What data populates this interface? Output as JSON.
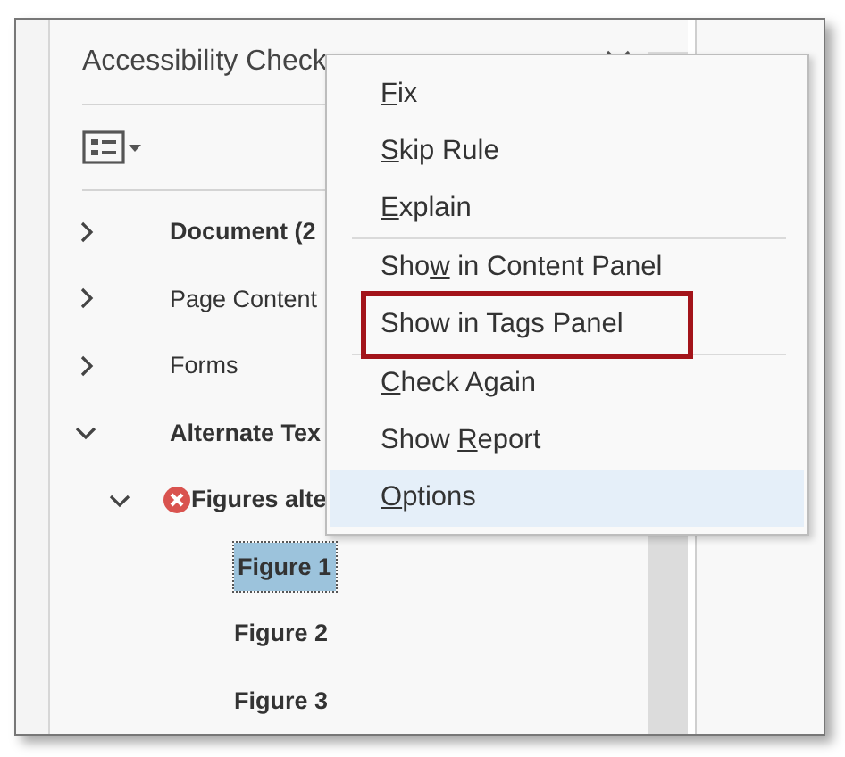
{
  "panel": {
    "title": "Accessibility Check"
  },
  "tree": [
    {
      "label": "Document (2",
      "bold": true,
      "expanded": false,
      "selected": false
    },
    {
      "label": "Page Content",
      "bold": false,
      "expanded": false,
      "selected": false
    },
    {
      "label": "Forms",
      "bold": false,
      "expanded": false,
      "selected": false
    },
    {
      "label": "Alternate Tex",
      "bold": true,
      "expanded": true,
      "selected": false,
      "children": [
        {
          "label": "Figures alte",
          "bold": true,
          "expanded": true,
          "selected": false,
          "error": true,
          "children": [
            {
              "label": "Figure 1",
              "bold": true,
              "selected": true
            },
            {
              "label": "Figure 2",
              "bold": true,
              "selected": false
            },
            {
              "label": "Figure 3",
              "bold": true,
              "selected": false
            }
          ]
        }
      ]
    }
  ],
  "context_menu": {
    "groups": [
      [
        {
          "key": "F",
          "post": "ix",
          "highlighted": false,
          "hovered": false
        },
        {
          "key": "S",
          "post": "kip Rule",
          "highlighted": false,
          "hovered": false
        },
        {
          "key": "E",
          "post": "xplain",
          "highlighted": false,
          "hovered": false
        }
      ],
      [
        {
          "pre": "Sho",
          "key": "w",
          "post": " in Content Panel",
          "highlighted": false,
          "hovered": false
        },
        {
          "pre": "Show in Tags Panel",
          "highlighted": true,
          "hovered": false
        }
      ],
      [
        {
          "key": "C",
          "post": "heck Again",
          "highlighted": false,
          "hovered": false
        },
        {
          "pre": "Show ",
          "key": "R",
          "post": "eport",
          "highlighted": false,
          "hovered": false
        },
        {
          "key": "O",
          "post": "ptions",
          "highlighted": false,
          "hovered": true
        }
      ]
    ]
  }
}
